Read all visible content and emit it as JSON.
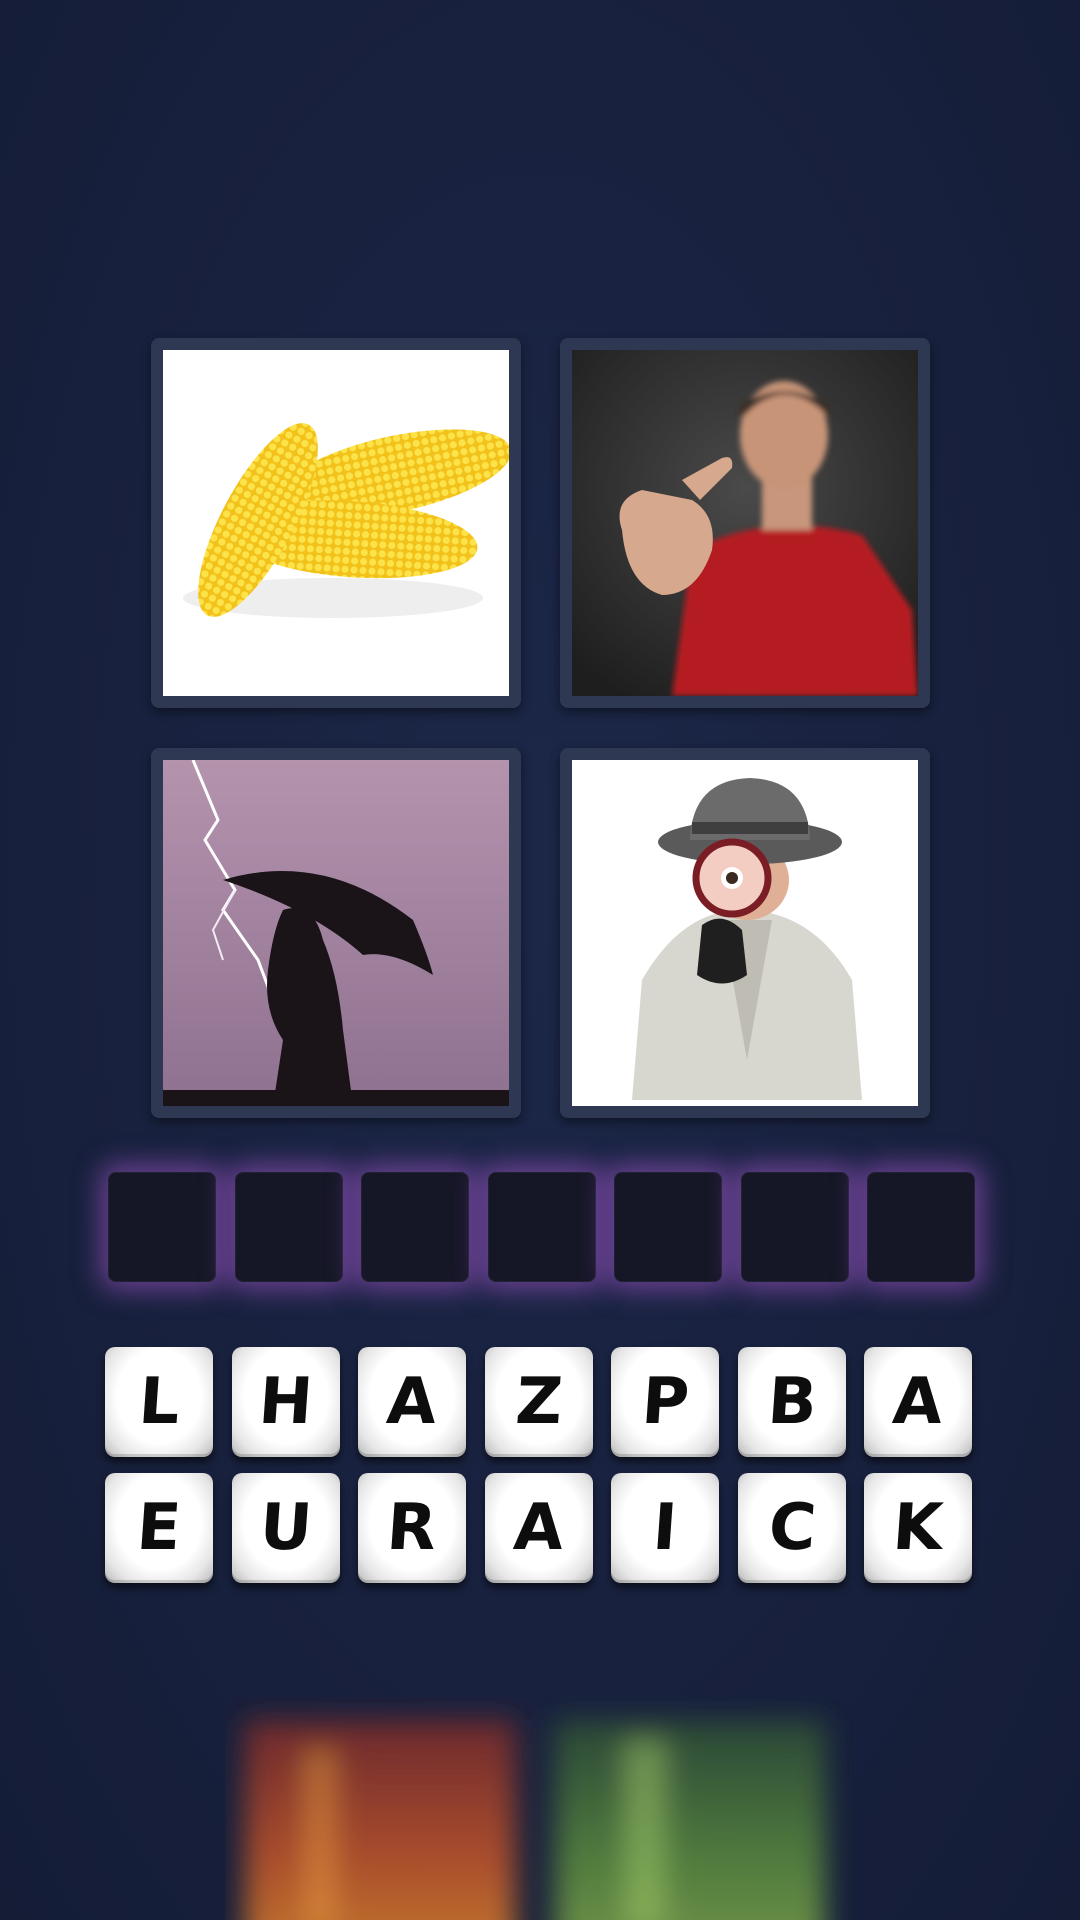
{
  "pictures": [
    {
      "subject": "corn-cobs"
    },
    {
      "subject": "man-pointing"
    },
    {
      "subject": "umbrella-lightning-silhouette"
    },
    {
      "subject": "detective-magnifying-glass"
    }
  ],
  "answer_slots": [
    "",
    "",
    "",
    "",
    "",
    "",
    ""
  ],
  "letters": {
    "row1": [
      "L",
      "H",
      "A",
      "Z",
      "P",
      "B",
      "A"
    ],
    "row2": [
      "E",
      "U",
      "R",
      "A",
      "I",
      "C",
      "K"
    ]
  },
  "colors": {
    "background": "#18223f",
    "frame": "#2e3852",
    "slot": "#151726",
    "slot_glow": "#aa5ad2",
    "tile": "#ffffff",
    "tile_text": "#0d0d0d"
  }
}
